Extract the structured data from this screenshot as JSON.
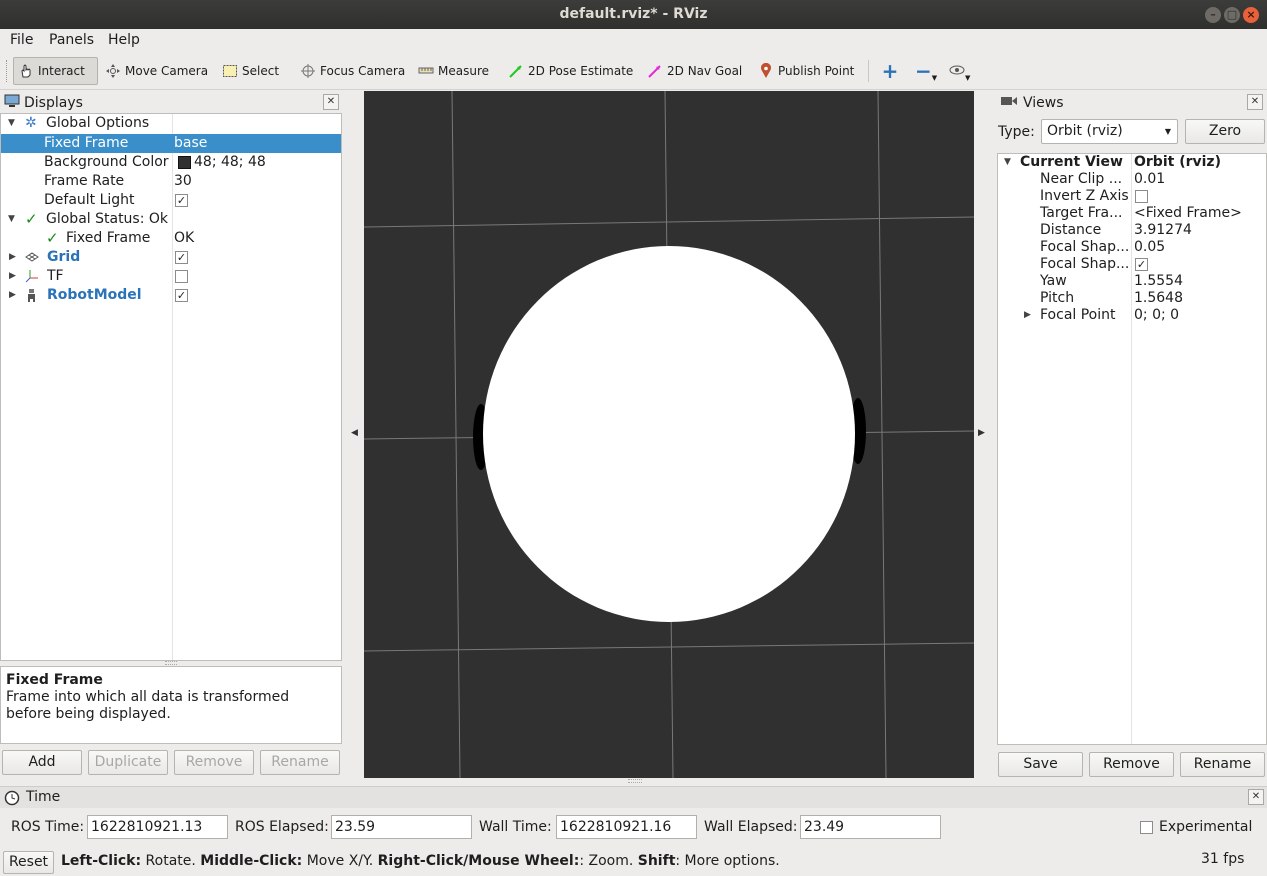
{
  "window": {
    "title": "default.rviz* - RViz"
  },
  "menu": [
    "File",
    "Panels",
    "Help"
  ],
  "toolbar": {
    "tools": [
      {
        "label": "Interact",
        "icon": "hand-icon"
      },
      {
        "label": "Move Camera",
        "icon": "move-camera-icon"
      },
      {
        "label": "Select",
        "icon": "select-icon"
      },
      {
        "label": "Focus Camera",
        "icon": "focus-camera-icon"
      },
      {
        "label": "Measure",
        "icon": "measure-icon"
      },
      {
        "label": "2D Pose Estimate",
        "icon": "pose-estimate-icon"
      },
      {
        "label": "2D Nav Goal",
        "icon": "nav-goal-icon"
      },
      {
        "label": "Publish Point",
        "icon": "publish-point-icon"
      }
    ]
  },
  "displays": {
    "title": "Displays",
    "rows": [
      {
        "name": "Global Options",
        "value": ""
      },
      {
        "name": "Fixed Frame",
        "value": "base"
      },
      {
        "name": "Background Color",
        "value": "48; 48; 48"
      },
      {
        "name": "Frame Rate",
        "value": "30"
      },
      {
        "name": "Default Light",
        "value": ""
      },
      {
        "name": "Global Status: Ok",
        "value": ""
      },
      {
        "name": "Fixed Frame",
        "value": "OK"
      },
      {
        "name": "Grid",
        "value": ""
      },
      {
        "name": "TF",
        "value": ""
      },
      {
        "name": "RobotModel",
        "value": ""
      }
    ],
    "description_title": "Fixed Frame",
    "description_text": "Frame into which all data is transformed before being displayed.",
    "buttons": {
      "add": "Add",
      "duplicate": "Duplicate",
      "remove": "Remove",
      "rename": "Rename"
    }
  },
  "views": {
    "title": "Views",
    "type_label": "Type:",
    "type_value": "Orbit (rviz)",
    "zero": "Zero",
    "rows": [
      {
        "name": "Current View",
        "value": "Orbit (rviz)"
      },
      {
        "name": "Near Clip ...",
        "value": "0.01"
      },
      {
        "name": "Invert Z Axis",
        "value": ""
      },
      {
        "name": "Target Fra...",
        "value": "<Fixed Frame>"
      },
      {
        "name": "Distance",
        "value": "3.91274"
      },
      {
        "name": "Focal Shap...",
        "value": "0.05"
      },
      {
        "name": "Focal Shap...",
        "value": ""
      },
      {
        "name": "Yaw",
        "value": "1.5554"
      },
      {
        "name": "Pitch",
        "value": "1.5648"
      },
      {
        "name": "Focal Point",
        "value": "0; 0; 0"
      }
    ],
    "buttons": {
      "save": "Save",
      "remove": "Remove",
      "rename": "Rename"
    }
  },
  "time": {
    "title": "Time",
    "ros_time_label": "ROS Time:",
    "ros_time": "1622810921.13",
    "ros_elapsed_label": "ROS Elapsed:",
    "ros_elapsed": "23.59",
    "wall_time_label": "Wall Time:",
    "wall_time": "1622810921.16",
    "wall_elapsed_label": "Wall Elapsed:",
    "wall_elapsed": "23.49",
    "experimental": "Experimental"
  },
  "status": {
    "reset": "Reset",
    "left_click": "Left-Click:",
    "left_click_text": " Rotate. ",
    "middle_click": "Middle-Click:",
    "middle_click_text": " Move X/Y. ",
    "right_click": "Right-Click/Mouse Wheel:",
    "right_click_text": ": Zoom. ",
    "shift": "Shift",
    "shift_text": ": More options.",
    "fps": "31 fps"
  },
  "colors": {
    "background": "#303030",
    "selection": "#3a8fcb",
    "accent_blue": "#2b73b8"
  }
}
